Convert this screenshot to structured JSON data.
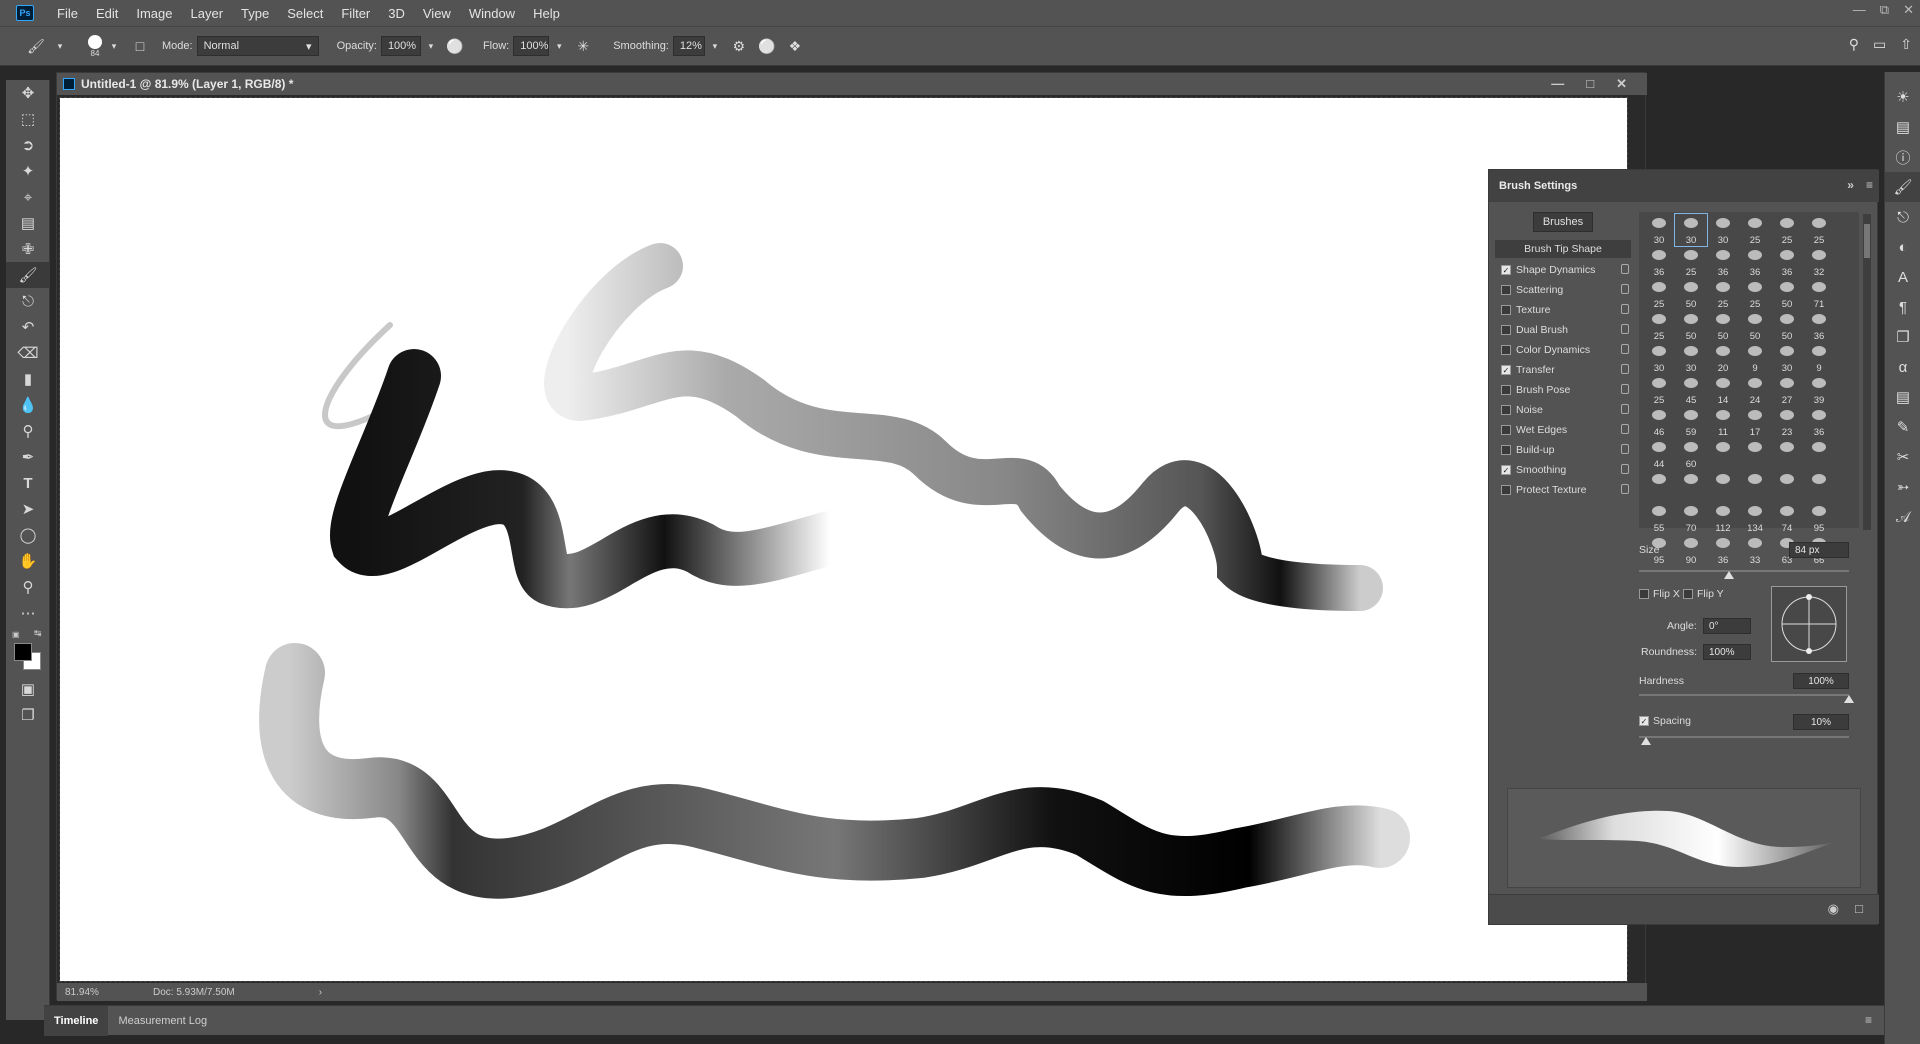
{
  "menubar": {
    "logo": "Ps",
    "items": [
      "File",
      "Edit",
      "Image",
      "Layer",
      "Type",
      "Select",
      "Filter",
      "3D",
      "View",
      "Window",
      "Help"
    ]
  },
  "options": {
    "brush_size": "84",
    "mode_label": "Mode:",
    "mode_value": "Normal",
    "opacity_label": "Opacity:",
    "opacity_value": "100%",
    "flow_label": "Flow:",
    "flow_value": "100%",
    "smoothing_label": "Smoothing:",
    "smoothing_value": "12%"
  },
  "document": {
    "title": "Untitled-1 @ 81.9% (Layer 1, RGB/8) *",
    "zoom": "81.94%",
    "doc_info": "Doc: 5.93M/7.50M"
  },
  "brush_panel": {
    "title": "Brush Settings",
    "brushes_button": "Brushes",
    "tip_shape": "Brush Tip Shape",
    "settings": [
      {
        "label": "Shape Dynamics",
        "checked": true
      },
      {
        "label": "Scattering",
        "checked": false
      },
      {
        "label": "Texture",
        "checked": false
      },
      {
        "label": "Dual Brush",
        "checked": false
      },
      {
        "label": "Color Dynamics",
        "checked": false
      },
      {
        "label": "Transfer",
        "checked": true
      },
      {
        "label": "Brush Pose",
        "checked": false
      },
      {
        "label": "Noise",
        "checked": false
      },
      {
        "label": "Wet Edges",
        "checked": false
      },
      {
        "label": "Build-up",
        "checked": false
      },
      {
        "label": "Smoothing",
        "checked": true
      },
      {
        "label": "Protect Texture",
        "checked": false
      }
    ],
    "presets": [
      "30",
      "30",
      "30",
      "25",
      "25",
      "25",
      "36",
      "25",
      "36",
      "36",
      "36",
      "32",
      "25",
      "50",
      "25",
      "25",
      "50",
      "71",
      "25",
      "50",
      "50",
      "50",
      "50",
      "36",
      "30",
      "30",
      "20",
      "9",
      "30",
      "9",
      "25",
      "45",
      "14",
      "24",
      "27",
      "39",
      "46",
      "59",
      "11",
      "17",
      "23",
      "36",
      "44",
      "60",
      "",
      "",
      "",
      "",
      "",
      "",
      "",
      "",
      "",
      "",
      "55",
      "70",
      "112",
      "134",
      "74",
      "95",
      "95",
      "90",
      "36",
      "33",
      "63",
      "66"
    ],
    "size_label": "Size",
    "size_value": "84 px",
    "flip_x": "Flip X",
    "flip_y": "Flip Y",
    "angle_label": "Angle:",
    "angle_value": "0°",
    "roundness_label": "Roundness:",
    "roundness_value": "100%",
    "hardness_label": "Hardness",
    "hardness_value": "100%",
    "spacing_label": "Spacing",
    "spacing_value": "10%"
  },
  "bottom_tabs": [
    "Timeline",
    "Measurement Log"
  ]
}
